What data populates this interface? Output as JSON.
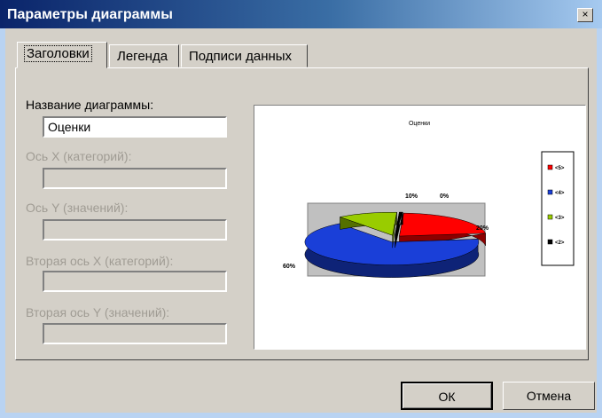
{
  "window": {
    "title": "Параметры диаграммы",
    "close_glyph": "×"
  },
  "tabs": [
    {
      "label": "Заголовки",
      "active": true
    },
    {
      "label": "Легенда",
      "active": false
    },
    {
      "label": "Подписи данных",
      "active": false
    }
  ],
  "fields": {
    "chart_title": {
      "label": "Название диаграммы:",
      "value": "Оценки"
    },
    "x_axis": {
      "label": "Ось X (категорий):",
      "value": ""
    },
    "y_axis": {
      "label": "Ось Y (значений):",
      "value": ""
    },
    "x2_axis": {
      "label": "Вторая ось X (категорий):",
      "value": ""
    },
    "y2_axis": {
      "label": "Вторая ось Y (значений):",
      "value": ""
    }
  },
  "buttons": {
    "ok": "ОК",
    "cancel": "Отмена"
  },
  "chart_data": {
    "type": "pie",
    "title": "Оценки",
    "categories": [
      "<5>",
      "<4>",
      "<3>",
      "<2>"
    ],
    "values": [
      20,
      60,
      10,
      0
    ],
    "data_labels": [
      "20%",
      "60%",
      "10%",
      "0%"
    ],
    "colors": [
      "#ff0000",
      "#1a3fd8",
      "#99cc00",
      "#000000"
    ],
    "legend_position": "right"
  }
}
